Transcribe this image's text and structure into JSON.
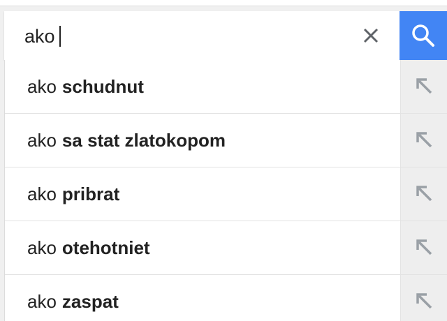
{
  "search": {
    "query": "ako",
    "clear_icon": "close-icon",
    "search_icon": "search-icon",
    "accent_color": "#4285f4"
  },
  "suggestions": [
    {
      "prefix": "ako",
      "completion": "schudnut",
      "fill_icon": "arrow-up-left-icon"
    },
    {
      "prefix": "ako",
      "completion": "sa stat zlatokopom",
      "fill_icon": "arrow-up-left-icon"
    },
    {
      "prefix": "ako",
      "completion": "pribrat",
      "fill_icon": "arrow-up-left-icon"
    },
    {
      "prefix": "ako",
      "completion": "otehotniet",
      "fill_icon": "arrow-up-left-icon"
    },
    {
      "prefix": "ako",
      "completion": "zaspat",
      "fill_icon": "arrow-up-left-icon"
    }
  ]
}
